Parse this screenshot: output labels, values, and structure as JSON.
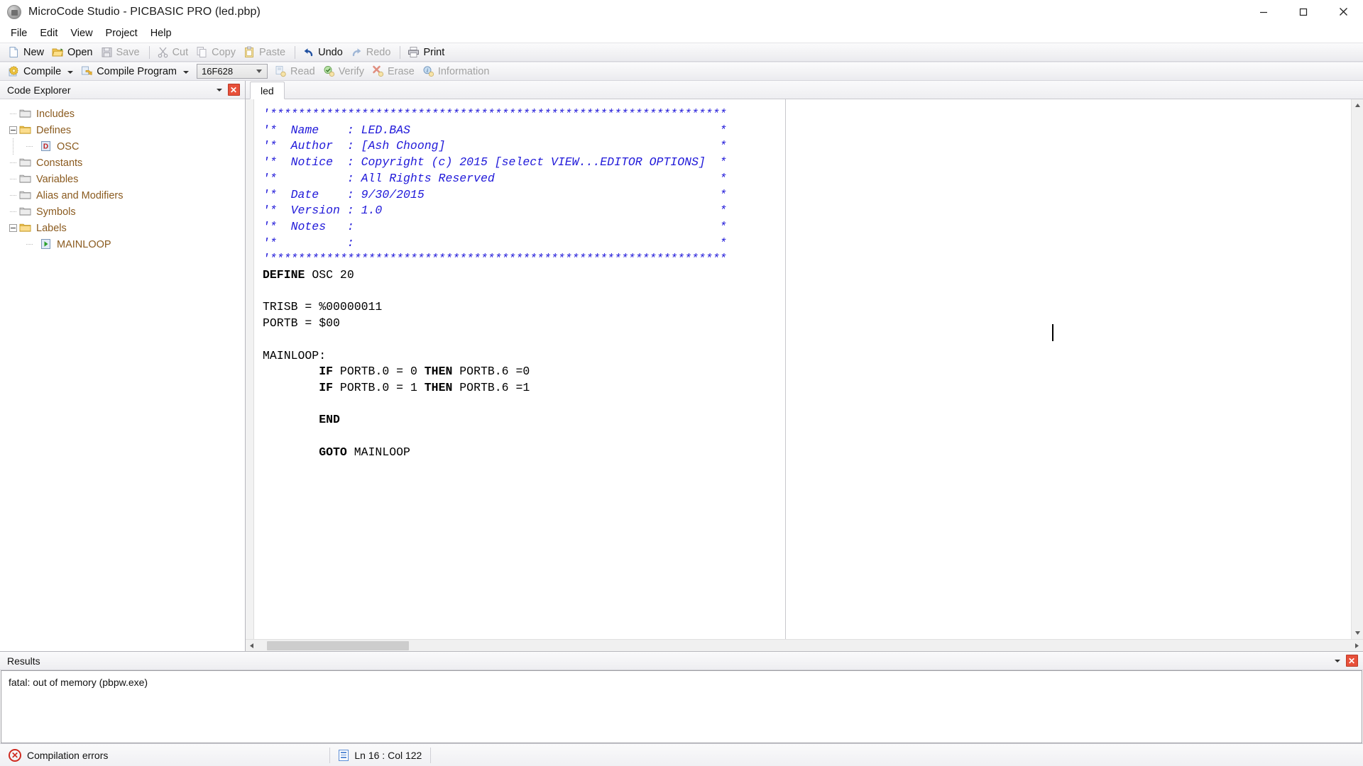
{
  "window": {
    "title": "MicroCode Studio - PICBASIC PRO (led.pbp)",
    "app_icon": "app-icon",
    "minimize_label": "Minimize",
    "maximize_label": "Maximize",
    "close_label": "Close"
  },
  "menubar": {
    "items": [
      {
        "label": "File"
      },
      {
        "label": "Edit"
      },
      {
        "label": "View"
      },
      {
        "label": "Project"
      },
      {
        "label": "Help"
      }
    ]
  },
  "toolbar_main": {
    "items": [
      {
        "label": "New",
        "icon": "new-document-icon",
        "enabled": true
      },
      {
        "label": "Open",
        "icon": "open-folder-icon",
        "enabled": true
      },
      {
        "label": "Save",
        "icon": "save-diskette-icon",
        "enabled": false
      },
      {
        "label": "Cut",
        "icon": "scissors-icon",
        "enabled": false
      },
      {
        "label": "Copy",
        "icon": "copy-icon",
        "enabled": false
      },
      {
        "label": "Paste",
        "icon": "clipboard-icon",
        "enabled": false
      },
      {
        "label": "Undo",
        "icon": "undo-arrow-icon",
        "enabled": true
      },
      {
        "label": "Redo",
        "icon": "redo-arrow-icon",
        "enabled": false
      },
      {
        "label": "Print",
        "icon": "printer-icon",
        "enabled": true
      }
    ]
  },
  "toolbar_compile": {
    "compile_label": "Compile",
    "compile_program_label": "Compile Program",
    "device": {
      "value": "16F628"
    },
    "items": [
      {
        "label": "Read",
        "icon": "read-icon",
        "enabled": false
      },
      {
        "label": "Verify",
        "icon": "verify-check-icon",
        "enabled": false
      },
      {
        "label": "Erase",
        "icon": "erase-x-icon",
        "enabled": false
      },
      {
        "label": "Information",
        "icon": "information-icon",
        "enabled": false
      }
    ]
  },
  "code_explorer": {
    "title": "Code Explorer",
    "nodes": [
      {
        "label": "Includes",
        "type": "folder",
        "expander": "none",
        "depth": 0
      },
      {
        "label": "Defines",
        "type": "folder-open",
        "expander": "minus",
        "depth": 0
      },
      {
        "label": "OSC",
        "type": "define",
        "expander": "none",
        "depth": 1
      },
      {
        "label": "Constants",
        "type": "folder",
        "expander": "none",
        "depth": 0
      },
      {
        "label": "Variables",
        "type": "folder",
        "expander": "none",
        "depth": 0
      },
      {
        "label": "Alias and Modifiers",
        "type": "folder",
        "expander": "none",
        "depth": 0
      },
      {
        "label": "Symbols",
        "type": "folder",
        "expander": "none",
        "depth": 0
      },
      {
        "label": "Labels",
        "type": "folder-open",
        "expander": "minus",
        "depth": 0
      },
      {
        "label": "MAINLOOP",
        "type": "label",
        "expander": "none",
        "depth": 1
      }
    ]
  },
  "editor": {
    "tabs": [
      {
        "label": "led",
        "active": true
      }
    ],
    "code_lines": [
      {
        "text": "'*****************************************************************",
        "style": "cmt"
      },
      {
        "text": "'*  Name    : LED.BAS                                            *",
        "style": "cmt"
      },
      {
        "text": "'*  Author  : [Ash Choong]                                       *",
        "style": "cmt"
      },
      {
        "text": "'*  Notice  : Copyright (c) 2015 [select VIEW...EDITOR OPTIONS]  *",
        "style": "cmt"
      },
      {
        "text": "'*          : All Rights Reserved                                *",
        "style": "cmt"
      },
      {
        "text": "'*  Date    : 9/30/2015                                          *",
        "style": "cmt"
      },
      {
        "text": "'*  Version : 1.0                                                *",
        "style": "cmt"
      },
      {
        "text": "'*  Notes   :                                                    *",
        "style": "cmt"
      },
      {
        "text": "'*          :                                                    *",
        "style": "cmt"
      },
      {
        "text": "'*****************************************************************",
        "style": "cmt"
      },
      {
        "segments": [
          {
            "t": "DEFINE",
            "s": "kw"
          },
          {
            "t": " OSC 20",
            "s": "pln"
          }
        ]
      },
      {
        "text": "",
        "style": "pln"
      },
      {
        "text": "TRISB = %00000011",
        "style": "pln"
      },
      {
        "text": "PORTB = $00",
        "style": "pln"
      },
      {
        "text": "",
        "style": "pln"
      },
      {
        "text": "MAINLOOP:",
        "style": "pln"
      },
      {
        "segments": [
          {
            "t": "        ",
            "s": "pln"
          },
          {
            "t": "IF",
            "s": "kw"
          },
          {
            "t": " PORTB.0 = 0 ",
            "s": "pln"
          },
          {
            "t": "THEN",
            "s": "kw"
          },
          {
            "t": " PORTB.6 =0",
            "s": "pln"
          }
        ]
      },
      {
        "segments": [
          {
            "t": "        ",
            "s": "pln"
          },
          {
            "t": "IF",
            "s": "kw"
          },
          {
            "t": " PORTB.0 = 1 ",
            "s": "pln"
          },
          {
            "t": "THEN",
            "s": "kw"
          },
          {
            "t": " PORTB.6 =1",
            "s": "pln"
          }
        ]
      },
      {
        "text": "",
        "style": "pln"
      },
      {
        "segments": [
          {
            "t": "        ",
            "s": "pln"
          },
          {
            "t": "END",
            "s": "kw"
          }
        ]
      },
      {
        "text": "",
        "style": "pln"
      },
      {
        "segments": [
          {
            "t": "        ",
            "s": "pln"
          },
          {
            "t": "GOTO",
            "s": "kw"
          },
          {
            "t": " MAINLOOP",
            "s": "pln"
          }
        ]
      }
    ]
  },
  "results": {
    "title": "Results",
    "messages": [
      "fatal: out of memory (pbpw.exe)"
    ]
  },
  "statusbar": {
    "compilation_status": "Compilation errors",
    "cursor_position": "Ln 16 : Col 122"
  },
  "colors": {
    "comment": "#2019d9",
    "keyword": "#000000",
    "tree_label": "#8a5a1e",
    "error_red": "#cf2a20",
    "close_red": "#e8503a"
  }
}
